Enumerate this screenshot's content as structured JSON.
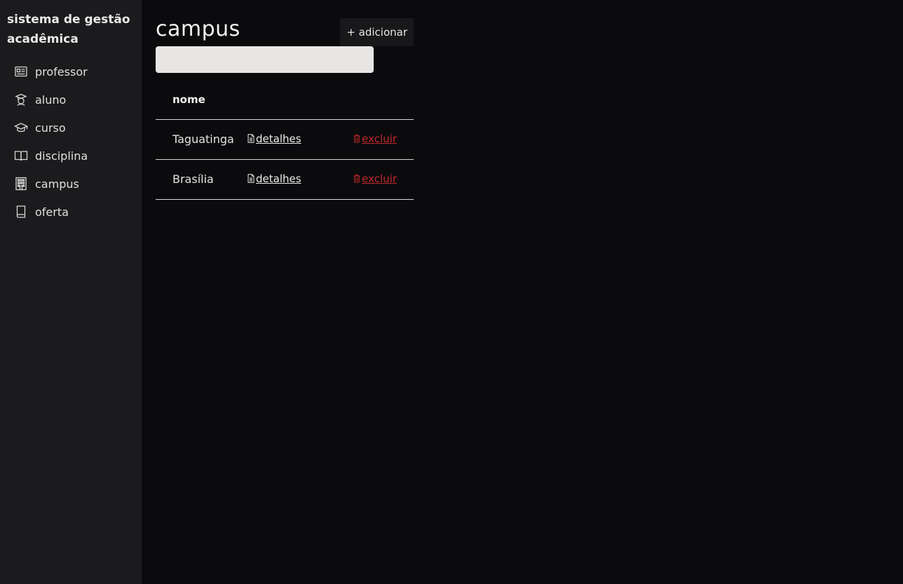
{
  "app": {
    "title": "sistema de gestão acadêmica"
  },
  "sidebar": {
    "items": [
      {
        "label": "professor",
        "icon": "id-card-icon"
      },
      {
        "label": "aluno",
        "icon": "student-icon"
      },
      {
        "label": "curso",
        "icon": "graduation-cap-icon"
      },
      {
        "label": "disciplina",
        "icon": "book-open-icon"
      },
      {
        "label": "campus",
        "icon": "building-icon"
      },
      {
        "label": "oferta",
        "icon": "book-icon"
      }
    ]
  },
  "page": {
    "title": "campus",
    "add_label": "+ adicionar",
    "search": {
      "value": "",
      "placeholder": ""
    }
  },
  "table": {
    "columns": [
      "nome"
    ],
    "details_label": "detalhes",
    "delete_label": "excluir",
    "rows": [
      {
        "name": "Taguatinga"
      },
      {
        "name": "Brasília"
      }
    ]
  },
  "colors": {
    "sidebar_bg": "#1b1b1d",
    "main_bg": "#0b0b0d",
    "danger": "#c0292d",
    "search_bg": "#e7e6e4"
  }
}
